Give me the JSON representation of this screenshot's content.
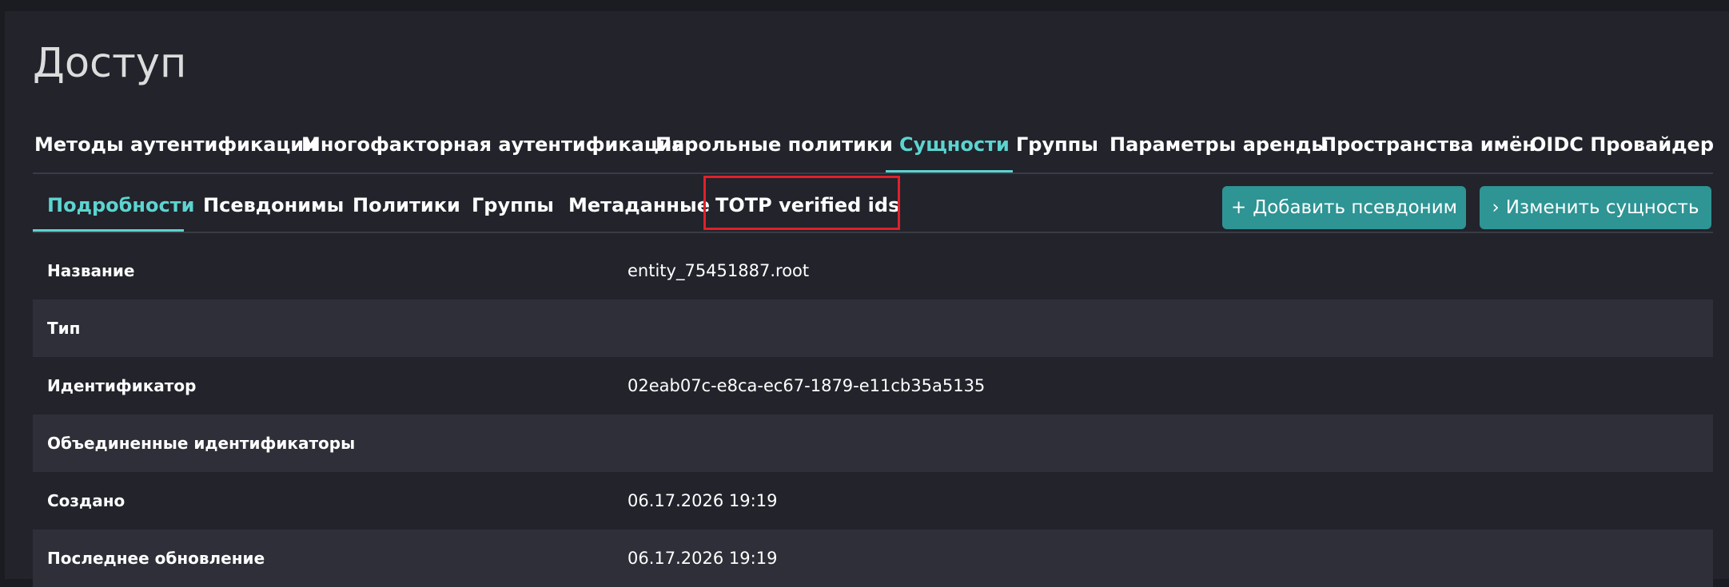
{
  "page": {
    "title": "Доступ"
  },
  "main_tabs": [
    {
      "label": "Методы аутентификации",
      "active": false
    },
    {
      "label": "Многофакторная аутентификация",
      "active": false
    },
    {
      "label": "Парольные политики",
      "active": false
    },
    {
      "label": "Сущности",
      "active": true
    },
    {
      "label": "Группы",
      "active": false
    },
    {
      "label": "Параметры аренды",
      "active": false
    },
    {
      "label": "Пространства имён",
      "active": false
    },
    {
      "label": "OIDC Провайдер",
      "active": false
    }
  ],
  "sub_tabs": [
    {
      "label": "Подробности",
      "active": true
    },
    {
      "label": "Псевдонимы",
      "active": false
    },
    {
      "label": "Политики",
      "active": false
    },
    {
      "label": "Группы",
      "active": false
    },
    {
      "label": "Метаданные",
      "active": false
    },
    {
      "label": "TOTP verified ids",
      "active": false,
      "highlighted": true
    }
  ],
  "actions": {
    "add_alias": {
      "label": "Добавить псевдоним",
      "icon": "plus-icon"
    },
    "edit_entity": {
      "label": "Изменить сущность",
      "icon": "chevron-right-icon"
    }
  },
  "details": [
    {
      "label": "Название",
      "value": "entity_75451887.root"
    },
    {
      "label": "Тип",
      "value": ""
    },
    {
      "label": "Идентификатор",
      "value": "02eab07c-e8ca-ec67-1879-e11cb35a5135"
    },
    {
      "label": "Объединенные идентификаторы",
      "value": ""
    },
    {
      "label": "Создано",
      "value": "06.17.2026 19:19"
    },
    {
      "label": "Последнее обновление",
      "value": "06.17.2026 19:19"
    }
  ],
  "colors": {
    "accent": "#5cd4d0",
    "button_bg": "#2e9494",
    "highlight_border": "#e0202a",
    "page_bg": "#22232b",
    "alt_row_bg": "#2e2f38"
  }
}
